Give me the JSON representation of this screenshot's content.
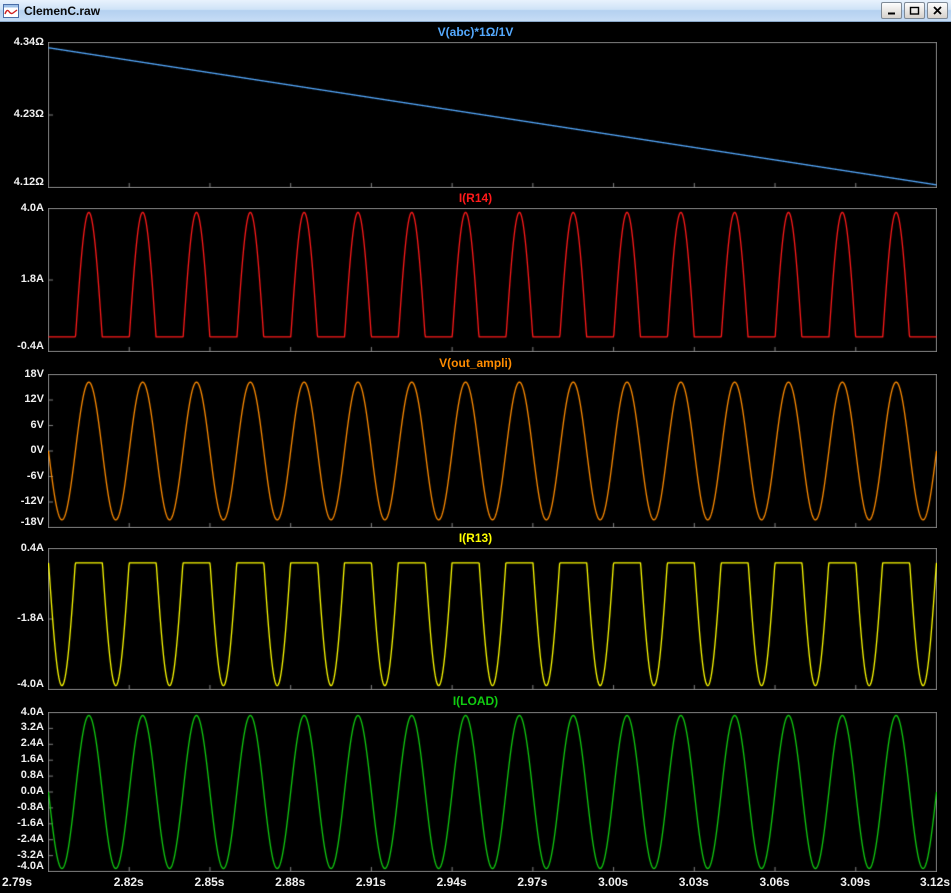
{
  "window": {
    "title": "ClemenC.raw"
  },
  "chart_data": {
    "type": "line",
    "background": "#000000",
    "frame_color": "#808080",
    "tick_label_color": "#f0f0f0",
    "grid": false,
    "x_axis": {
      "xlim": [
        2.79,
        3.12
      ],
      "unit": "s",
      "ticks": [
        "2.79s",
        "2.82s",
        "2.85s",
        "2.88s",
        "2.91s",
        "2.94s",
        "2.97s",
        "3.00s",
        "3.03s",
        "3.06s",
        "3.09s",
        "3.12s"
      ]
    },
    "panes": [
      {
        "title": "V(abc)*1Ω/1V",
        "color": "#55aaff",
        "ylim": [
          4.12,
          4.34
        ],
        "yticks": [
          {
            "v": 4.34,
            "label": "4.34Ω"
          },
          {
            "v": 4.23,
            "label": "4.23Ω"
          },
          {
            "v": 4.12,
            "label": "4.12Ω"
          }
        ],
        "waveform": {
          "kind": "ramp",
          "start": 4.332,
          "end": 4.124
        }
      },
      {
        "title": "I(R14)",
        "color": "#ff1a1a",
        "ylim": [
          -0.4,
          4.0
        ],
        "yticks": [
          {
            "v": 4.0,
            "label": "4.0A"
          },
          {
            "v": 1.8,
            "label": "1.8A"
          },
          {
            "v": -0.4,
            "label": "-0.4A"
          }
        ],
        "waveform": {
          "kind": "halfsine_pos",
          "amplitude": 3.88,
          "clip_level": 0.05,
          "frequency_hz": 50
        }
      },
      {
        "title": "V(out_ampli)",
        "color": "#ff8c00",
        "ylim": [
          -18,
          18
        ],
        "yticks": [
          {
            "v": 18,
            "label": "18V"
          },
          {
            "v": 12,
            "label": "12V"
          },
          {
            "v": 6,
            "label": "6V"
          },
          {
            "v": 0,
            "label": "0V"
          },
          {
            "v": -6,
            "label": "-6V"
          },
          {
            "v": -12,
            "label": "-12V"
          },
          {
            "v": -18,
            "label": "-18V"
          }
        ],
        "waveform": {
          "kind": "sine",
          "amplitude": 16.2,
          "frequency_hz": 50
        }
      },
      {
        "title": "I(R13)",
        "color": "#ffff00",
        "ylim": [
          -4.0,
          0.4
        ],
        "yticks": [
          {
            "v": 0.4,
            "label": "0.4A"
          },
          {
            "v": -1.8,
            "label": "-1.8A"
          },
          {
            "v": -4.0,
            "label": "-4.0A"
          }
        ],
        "waveform": {
          "kind": "halfsine_neg",
          "amplitude": 3.88,
          "clip_level": -0.05,
          "frequency_hz": 50
        }
      },
      {
        "title": "I(LOAD)",
        "color": "#11cc11",
        "ylim": [
          -4.0,
          4.0
        ],
        "yticks": [
          {
            "v": 4.0,
            "label": "4.0A"
          },
          {
            "v": 3.2,
            "label": "3.2A"
          },
          {
            "v": 2.4,
            "label": "2.4A"
          },
          {
            "v": 1.6,
            "label": "1.6A"
          },
          {
            "v": 0.8,
            "label": "0.8A"
          },
          {
            "v": 0.0,
            "label": "0.0A"
          },
          {
            "v": -0.8,
            "label": "-0.8A"
          },
          {
            "v": -1.6,
            "label": "-1.6A"
          },
          {
            "v": -2.4,
            "label": "-2.4A"
          },
          {
            "v": -3.2,
            "label": "-3.2A"
          },
          {
            "v": -4.0,
            "label": "-4.0A"
          }
        ],
        "waveform": {
          "kind": "sine",
          "amplitude": 3.85,
          "frequency_hz": 50
        }
      }
    ]
  }
}
